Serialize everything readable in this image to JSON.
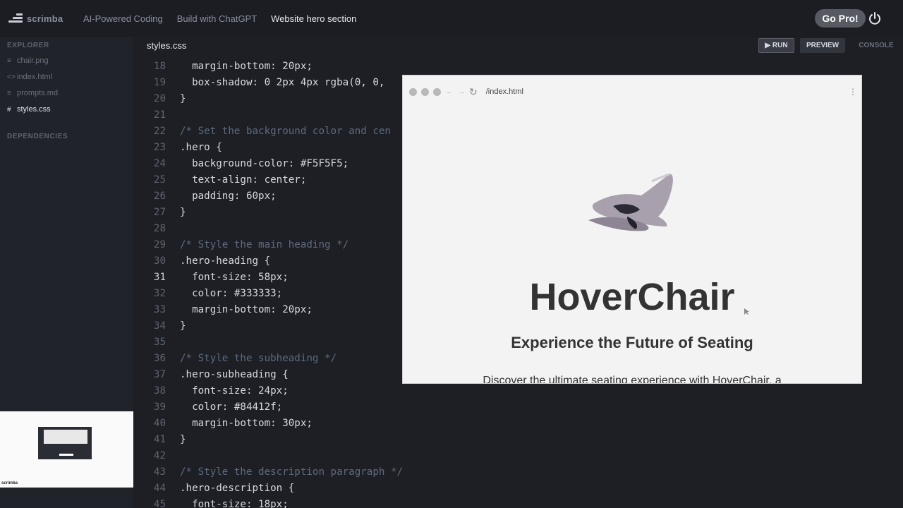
{
  "topbar": {
    "logo_text": "scrimba",
    "breadcrumbs": [
      "AI-Powered Coding",
      "Build with ChatGPT",
      "Website hero section"
    ],
    "go_pro": "Go Pro!"
  },
  "sidebar": {
    "explorer_label": "EXPLORER",
    "files": [
      {
        "icon": "≡",
        "name": "chair.png"
      },
      {
        "icon": "<>",
        "name": "index.html"
      },
      {
        "icon": "≡",
        "name": "prompts.md"
      },
      {
        "icon": "#",
        "name": "styles.css"
      }
    ],
    "dependencies_label": "DEPENDENCIES",
    "thumb_footer": "scrimba"
  },
  "editor": {
    "file_tab": "styles.css",
    "run_label": "▶ RUN",
    "preview_label": "PREVIEW",
    "console_label": "CONSOLE",
    "lines": [
      {
        "n": "18",
        "t": "  margin-bottom: 20px;"
      },
      {
        "n": "19",
        "t": "  box-shadow: 0 2px 4px rgba(0, 0,"
      },
      {
        "n": "20",
        "t": "}"
      },
      {
        "n": "21",
        "t": ""
      },
      {
        "n": "22",
        "t": "/* Set the background color and cen"
      },
      {
        "n": "23",
        "t": ".hero {"
      },
      {
        "n": "24",
        "t": "  background-color: #F5F5F5;"
      },
      {
        "n": "25",
        "t": "  text-align: center;"
      },
      {
        "n": "26",
        "t": "  padding: 60px;"
      },
      {
        "n": "27",
        "t": "}"
      },
      {
        "n": "28",
        "t": ""
      },
      {
        "n": "29",
        "t": "/* Style the main heading */"
      },
      {
        "n": "30",
        "t": ".hero-heading {"
      },
      {
        "n": "31",
        "t": "  font-size: 58px;"
      },
      {
        "n": "32",
        "t": "  color: #333333;"
      },
      {
        "n": "33",
        "t": "  margin-bottom: 20px;"
      },
      {
        "n": "34",
        "t": "}"
      },
      {
        "n": "35",
        "t": ""
      },
      {
        "n": "36",
        "t": "/* Style the subheading */"
      },
      {
        "n": "37",
        "t": ".hero-subheading {"
      },
      {
        "n": "38",
        "t": "  font-size: 24px;"
      },
      {
        "n": "39",
        "t": "  color: #84412f;"
      },
      {
        "n": "40",
        "t": "  margin-bottom: 30px;"
      },
      {
        "n": "41",
        "t": "}"
      },
      {
        "n": "42",
        "t": ""
      },
      {
        "n": "43",
        "t": "/* Style the description paragraph */"
      },
      {
        "n": "44",
        "t": ".hero-description {"
      },
      {
        "n": "45",
        "t": "  font-size: 18px;"
      }
    ]
  },
  "preview": {
    "url": "/index.html",
    "heading": "HoverChair",
    "subheading": "Experience the Future of Seating",
    "description": "Discover the ultimate seating experience with HoverChair, a"
  }
}
